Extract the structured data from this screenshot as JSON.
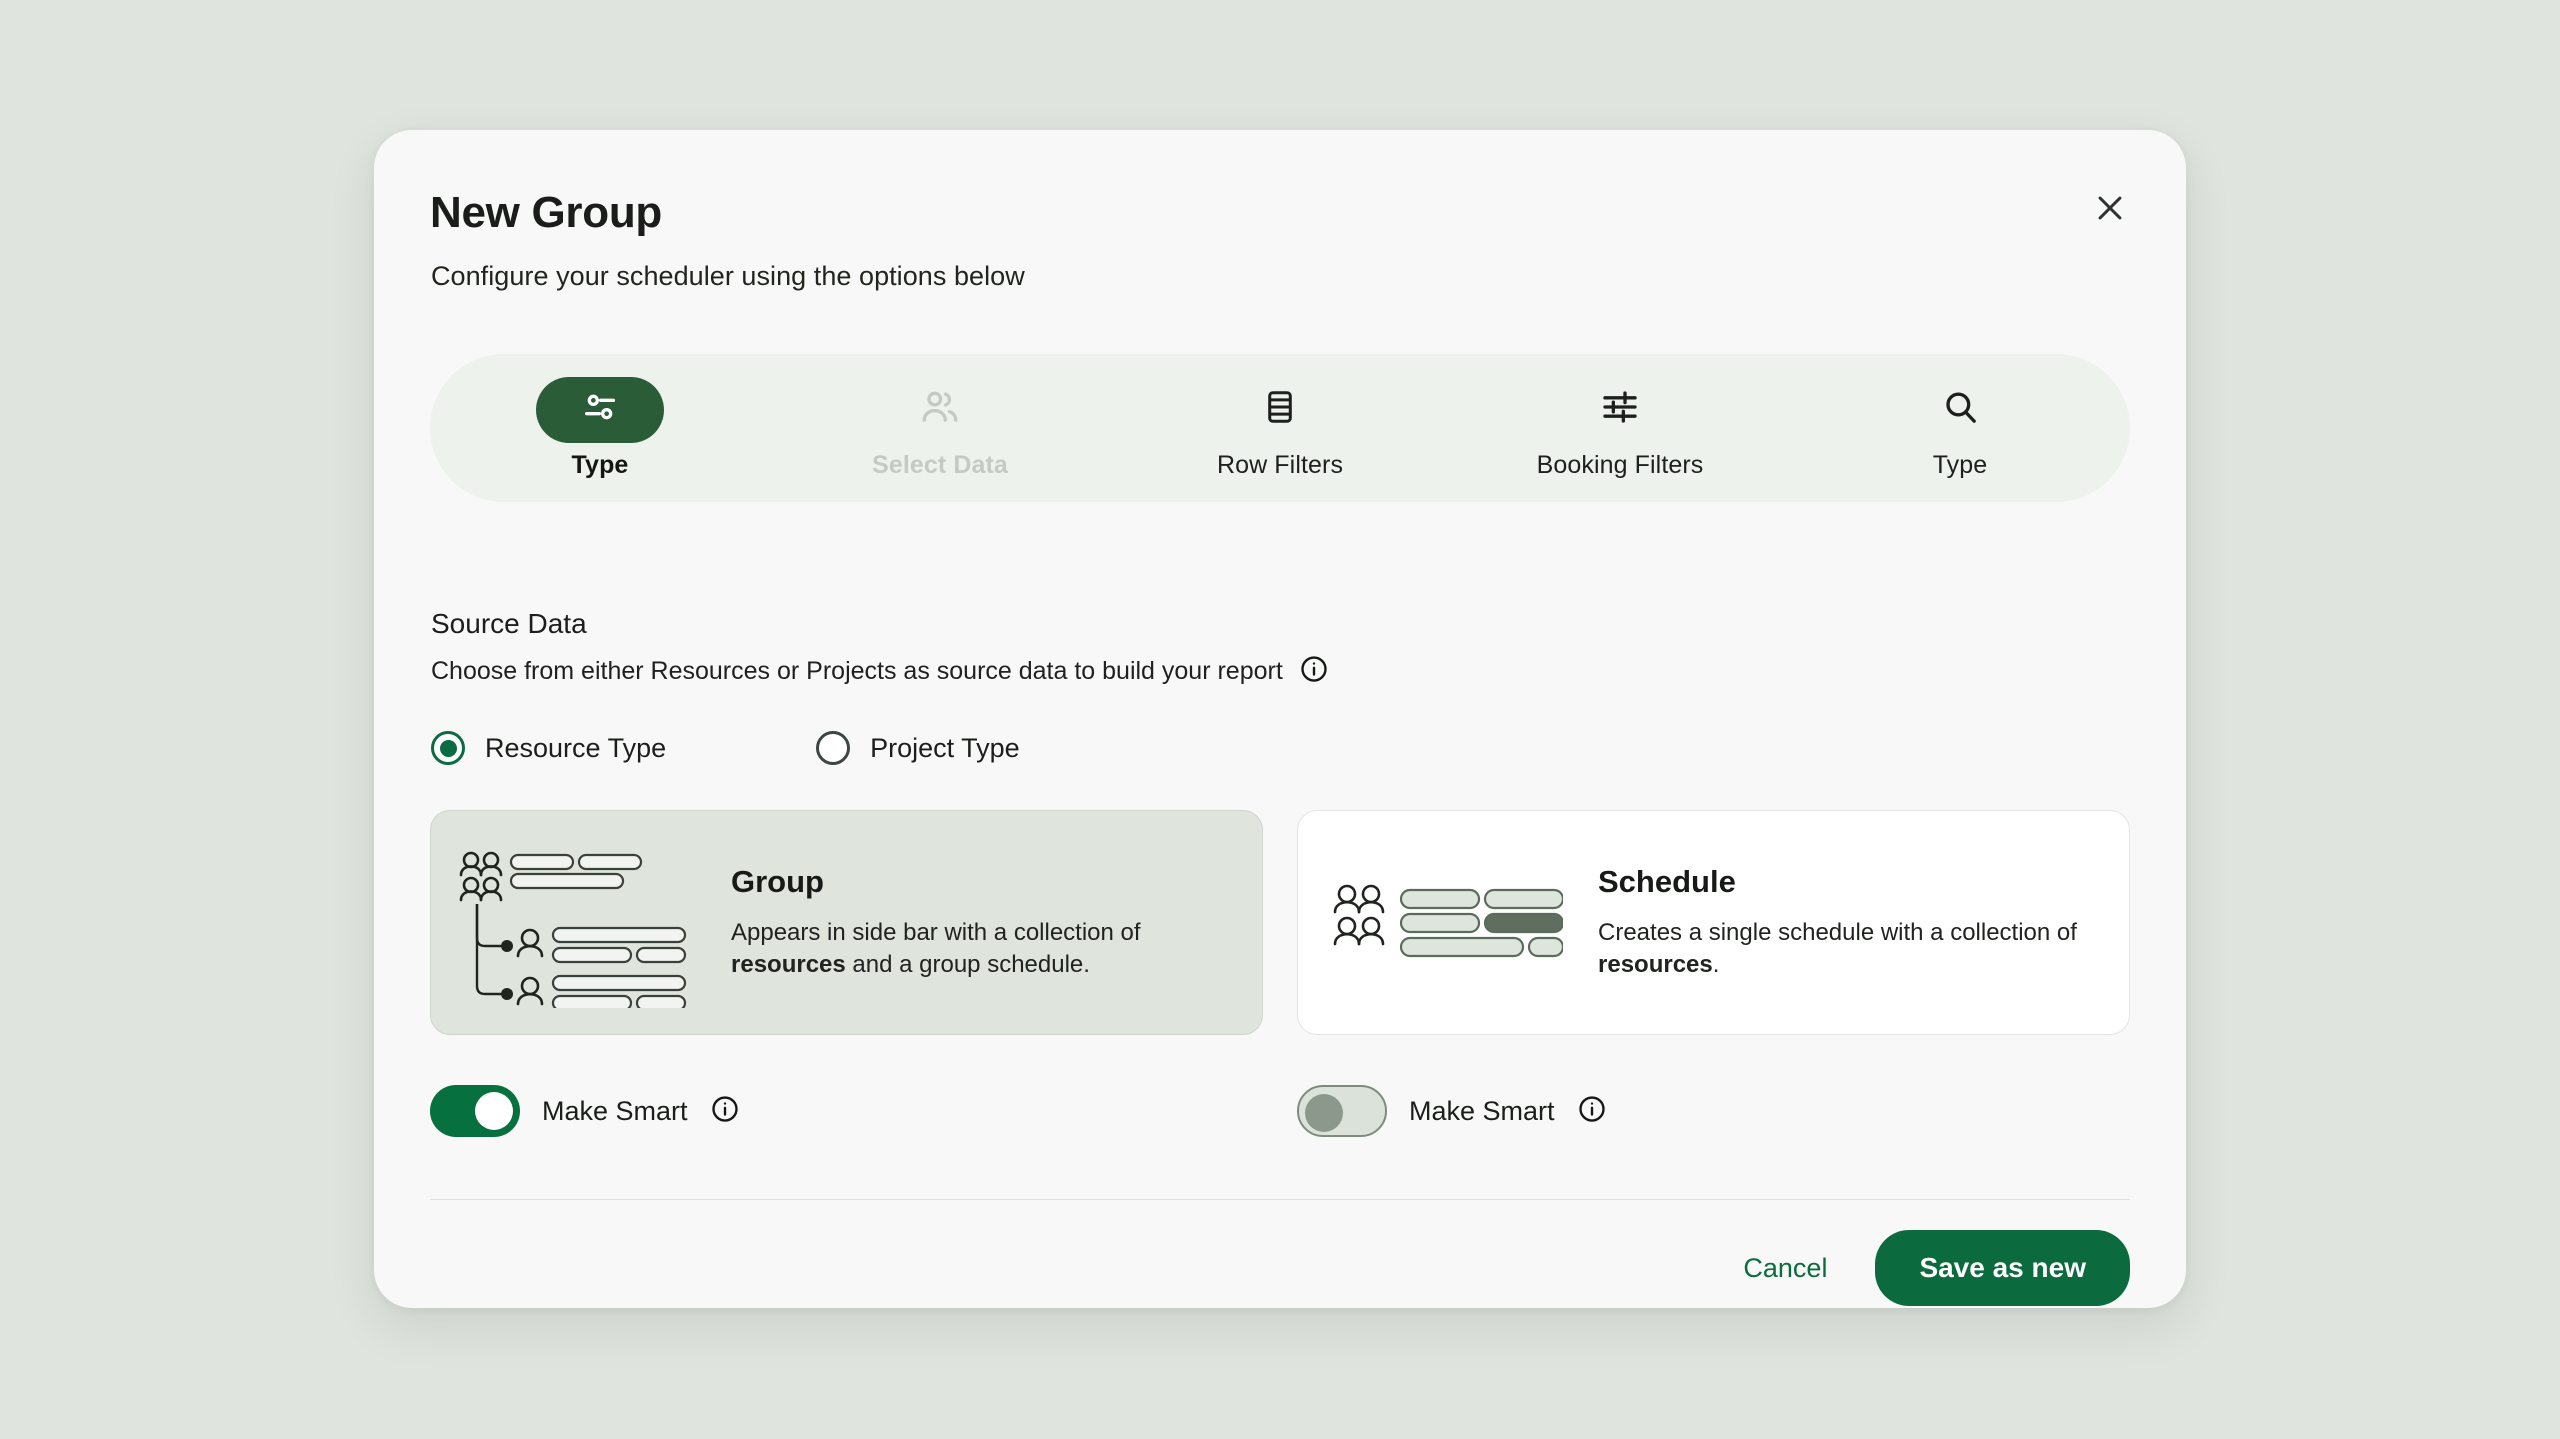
{
  "dialog": {
    "title": "New Group",
    "subtitle": "Configure your scheduler using the options below",
    "close_icon": "close-icon"
  },
  "stepper": {
    "steps": [
      {
        "label": "Type",
        "icon": "sliders-toggle-icon",
        "state": "active"
      },
      {
        "label": "Select Data",
        "icon": "users-icon",
        "state": "disabled"
      },
      {
        "label": "Row Filters",
        "icon": "rows-table-icon",
        "state": "default"
      },
      {
        "label": "Booking Filters",
        "icon": "filter-sliders-icon",
        "state": "default"
      },
      {
        "label": "Type",
        "icon": "search-icon",
        "state": "default"
      }
    ]
  },
  "source_data": {
    "title": "Source Data",
    "description": "Choose from either Resources or Projects as source data to build your report",
    "info_icon": "info-icon",
    "radios": [
      {
        "label": "Resource Type",
        "selected": true
      },
      {
        "label": "Project Type",
        "selected": false
      }
    ]
  },
  "options": [
    {
      "heading": "Group",
      "description_pre": "Appears in side bar with a collection of ",
      "description_bold": "resources",
      "description_post": " and a group schedule.",
      "selected": true,
      "illustration": "group-hierarchy-illustration",
      "toggle": {
        "label": "Make Smart",
        "on": true,
        "info_icon": "info-icon"
      }
    },
    {
      "heading": "Schedule",
      "description_pre": "Creates a single schedule with a collection of ",
      "description_bold": "resources",
      "description_post": ".",
      "selected": false,
      "illustration": "schedule-bars-illustration",
      "toggle": {
        "label": "Make Smart",
        "on": false,
        "info_icon": "info-icon"
      }
    }
  ],
  "footer": {
    "cancel_label": "Cancel",
    "save_label": "Save as new"
  },
  "colors": {
    "page_background": "#dfe4de",
    "dialog_background": "#f7f8f7",
    "accent_green": "#0b6b3e",
    "active_step_green": "#2b5c38",
    "stepper_background": "#edf2ec",
    "selected_card_background": "#dfe4dd",
    "disabled_step_text": "#c3cbc2"
  }
}
